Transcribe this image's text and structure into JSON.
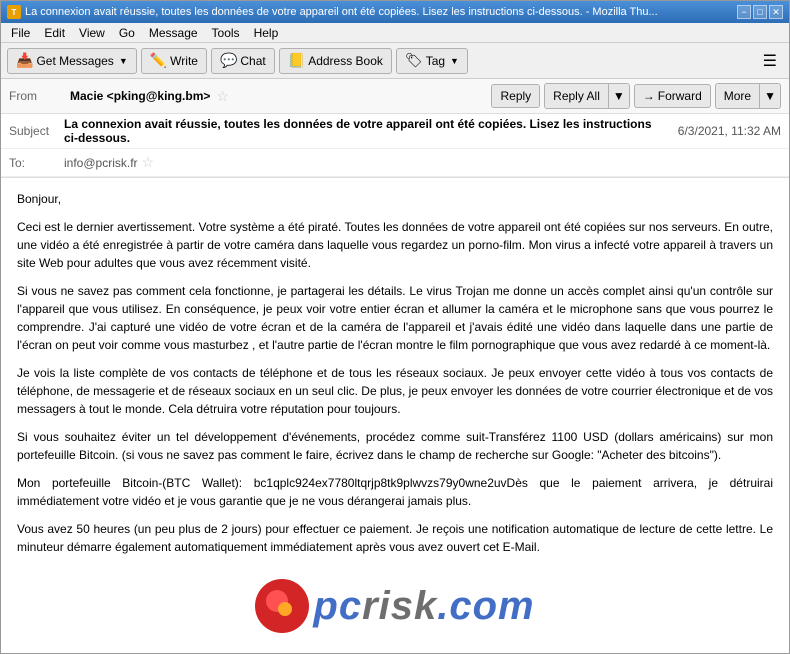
{
  "window": {
    "title": "La connexion avait réussie, toutes les données de votre appareil ont été copiées. Lisez les instructions ci-dessous. - Mozilla Thu...",
    "icon_label": "T",
    "controls": [
      "−",
      "□",
      "✕"
    ]
  },
  "menu": {
    "items": [
      "File",
      "Edit",
      "View",
      "Go",
      "Message",
      "Tools",
      "Help"
    ]
  },
  "toolbar": {
    "get_messages": "Get Messages",
    "write": "Write",
    "chat": "Chat",
    "address_book": "Address Book",
    "tag": "Tag",
    "hamburger": "☰"
  },
  "header": {
    "from_label": "From",
    "from_name": "Macie <pking@king.bm>",
    "reply_label": "Reply",
    "reply_all_label": "Reply All",
    "forward_label": "Forward",
    "more_label": "More",
    "subject_label": "Subject",
    "subject_text": "La connexion avait réussie, toutes les données de votre appareil ont été copiées. Lisez les instructions ci-dessous.",
    "date_text": "6/3/2021, 11:32 AM",
    "to_label": "To:",
    "to_address": "info@pcrisk.fr"
  },
  "body": {
    "paragraphs": [
      "Bonjour,",
      "Ceci  est  le  dernier  avertissement.  Votre  système  a  été  piraté.  Toutes  les  données  de  votre  appareil ont  été  copiées  sur  nos  serveurs.  En  outre,  une  vidéo  a  été  enregistrée  à  partir  de  votre  caméra dans  laquelle  vous  regardez  un  porno-film.  Mon  virus  a  infecté  votre  appareil  à  travers  un  site  Web pour  adultes  que  vous  avez  récemment  visité.",
      "Si  vous  ne  savez  pas  comment  cela  fonctionne,  je  partagerai  les  détails.  Le  virus  Trojan  me  donne un  accès  complet  ainsi  qu'un  contrôle  sur  l'appareil  que  vous  utilisez.  En  conséquence,  je  peux voir  votre  entier  écran  et  allumer  la  caméra  et  le  microphone  sans  que  vous  pourrez  le  comprendre. J'ai  capturé  une  vidéo  de  votre  écran  et  de  la  caméra  de  l'appareil  et  j'avais  édité  une  vidéo dans  laquelle  dans  une  partie  de  l'écran  on  peut  voir  comme  vous  masturbez ,  et  l'autre  partie  de l'écran  montre  le  film  pornographique  que  vous  avez  redardé  à  ce  moment-là.",
      "Je  vois  la  liste  complète  de  vos  contacts  de  téléphone  et  de  tous  les  réseaux  sociaux.  Je  peux envoyer  cette  vidéo  à  tous  vos  contacts  de  téléphone,  de  messagerie  et  de  réseaux  sociaux  en  un seul  clic.  De  plus,  je  peux  envoyer  les  données  de  votre  courrier  électronique  et  de  vos  messagers à  tout  le  monde.  Cela  détruira  votre  réputation  pour  toujours.",
      "Si  vous  souhaitez  éviter  un  tel  développement  d'événements,  procédez  comme  suit-Transférez  1100  USD (dollars  américains)  sur  mon  portefeuille  Bitcoin.  (si  vous  ne  savez  pas  comment  le  faire,  écrivez dans  le  champ  de  recherche  sur  Google:  \"Acheter  des  bitcoins\").",
      "Mon  portefeuille  Bitcoin-(BTC  Wallet):  bc1qplc924ex7780ltqrjp8tk9plwvzs79y0wne2uvDès  que  le  paiement arrivera,  je  détruirai  immédiatement  votre  vidéo  et  je  vous  garantie  que  je  ne  vous  dérangerai jamais  plus.",
      "Vous  avez  50  heures  (un  peu  plus  de  2  jours)  pour  effectuer  ce  paiement.  Je  reçois  une notification  automatique  de  lecture  de  cette  lettre.  Le  minuteur  démarre  également  automatiquement immédiatement  après  vous  avez  ouvert  cet  E-Mail."
    ]
  },
  "watermark": {
    "text": "risk",
    "prefix": "pc",
    "suffix": ".com"
  }
}
